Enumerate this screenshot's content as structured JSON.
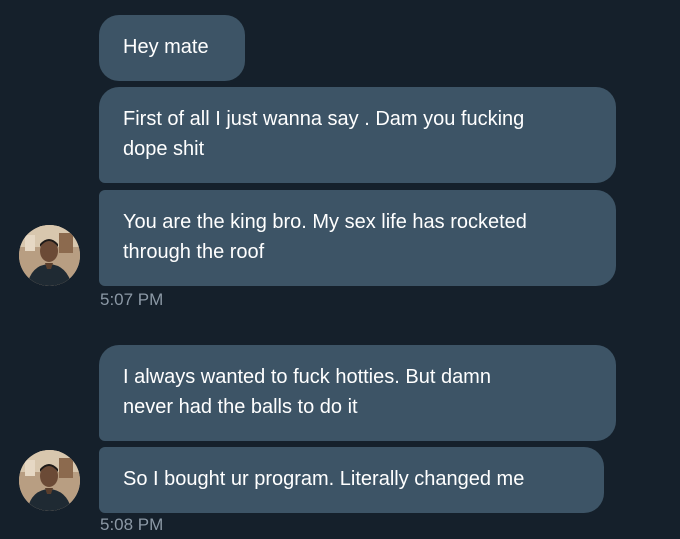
{
  "messages": [
    {
      "text": "Hey mate"
    },
    {
      "text": "First of all I just wanna say . Dam you fucking\ndope shit"
    },
    {
      "text": "You are the king bro. My sex life has rocketed\nthrough the roof"
    },
    {
      "text": "I always wanted to fuck hotties. But damn\nnever had the balls to do it"
    },
    {
      "text": "So I bought ur program. Literally changed me"
    }
  ],
  "timestamps": [
    "5:07 PM",
    "5:08 PM"
  ],
  "colors": {
    "background": "#15202b",
    "bubble": "#3d5466",
    "text": "#ffffff",
    "timestamp": "#8b98a5"
  },
  "icons": {
    "avatar": "user-avatar-photo"
  }
}
